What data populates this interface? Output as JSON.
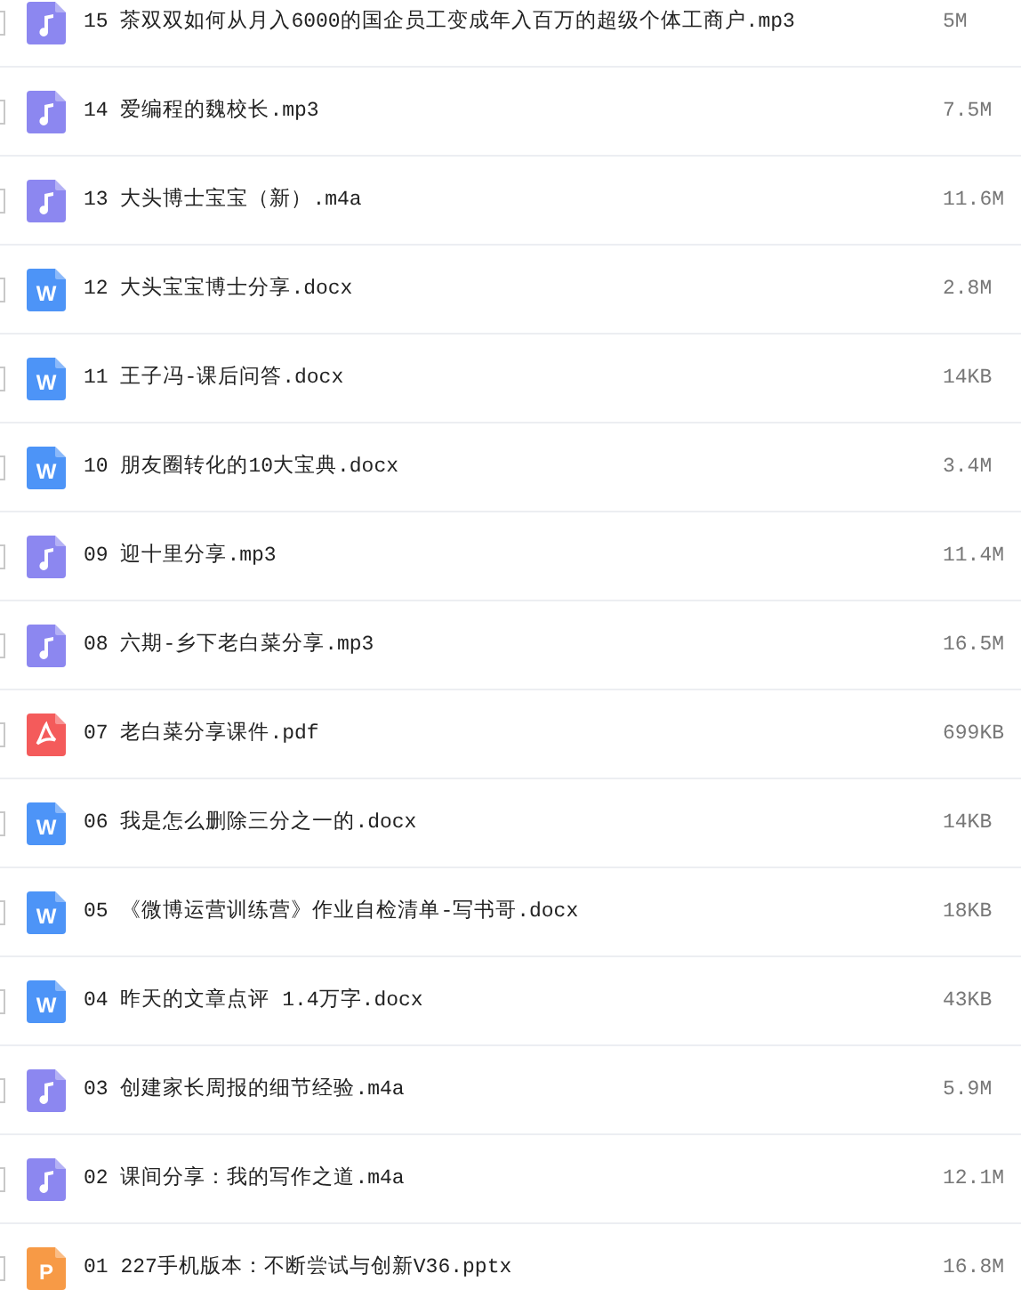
{
  "files": [
    {
      "kind": "audio",
      "checked": false,
      "name": "15 茶双双如何从月入6000的国企员工变成年入百万的超级个体工商户.mp3",
      "size": "5M"
    },
    {
      "kind": "audio",
      "checked": false,
      "name": "14 爱编程的魏校长.mp3",
      "size": "7.5M"
    },
    {
      "kind": "audio",
      "checked": false,
      "name": "13 大头博士宝宝（新）.m4a",
      "size": "11.6M"
    },
    {
      "kind": "word",
      "checked": false,
      "icon_letter": "W",
      "name": "12 大头宝宝博士分享.docx",
      "size": "2.8M"
    },
    {
      "kind": "word",
      "checked": false,
      "icon_letter": "W",
      "name": "11 王子冯-课后问答.docx",
      "size": "14KB"
    },
    {
      "kind": "word",
      "checked": false,
      "icon_letter": "W",
      "name": "10 朋友圈转化的10大宝典.docx",
      "size": "3.4M"
    },
    {
      "kind": "audio",
      "checked": false,
      "name": "09 迎十里分享.mp3",
      "size": "11.4M"
    },
    {
      "kind": "audio",
      "checked": false,
      "name": "08 六期-乡下老白菜分享.mp3",
      "size": "16.5M"
    },
    {
      "kind": "pdf",
      "checked": false,
      "name": "07 老白菜分享课件.pdf",
      "size": "699KB"
    },
    {
      "kind": "word",
      "checked": false,
      "icon_letter": "W",
      "name": "06 我是怎么删除三分之一的.docx",
      "size": "14KB"
    },
    {
      "kind": "word",
      "checked": false,
      "icon_letter": "W",
      "name": "05 《微博运营训练营》作业自检清单-写书哥.docx",
      "size": "18KB"
    },
    {
      "kind": "word",
      "checked": false,
      "icon_letter": "W",
      "name": "04 昨天的文章点评 1.4万字.docx",
      "size": "43KB"
    },
    {
      "kind": "audio",
      "checked": false,
      "name": "03 创建家长周报的细节经验.m4a",
      "size": "5.9M"
    },
    {
      "kind": "audio",
      "checked": false,
      "name": "02 课间分享：我的写作之道.m4a",
      "size": "12.1M"
    },
    {
      "kind": "ppt",
      "checked": false,
      "icon_letter": "P",
      "name": "01 227手机版本：不断尝试与创新V36.pptx",
      "size": "16.8M"
    }
  ]
}
